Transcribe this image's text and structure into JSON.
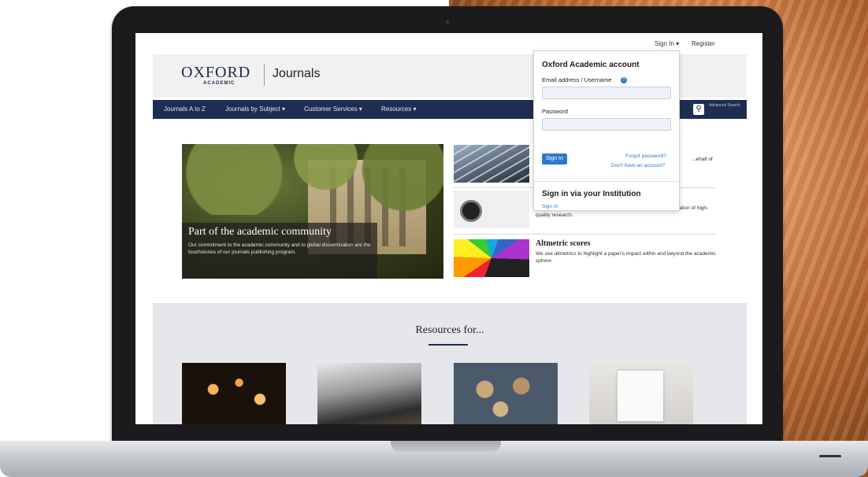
{
  "utility": {
    "sign_in": "Sign In ▾",
    "register": "Register"
  },
  "header": {
    "logo_main": "OXFORD",
    "logo_sub": "ACADEMIC",
    "site_name": "Journals"
  },
  "nav": {
    "items": [
      {
        "label": "Journals A to Z"
      },
      {
        "label": "Journals by Subject ▾"
      },
      {
        "label": "Customer Services ▾"
      },
      {
        "label": "Resources ▾"
      }
    ],
    "search_icon": "search-icon",
    "advanced_search": "Advanced Search"
  },
  "hero": {
    "title": "Part of the academic community",
    "text": "Our commitment to the academic community and to global dissemination are the touchstones of our journals publishing program."
  },
  "features": [
    {
      "title": "",
      "text": "...ehalf of"
    },
    {
      "title": "",
      "text": "We are mission-driven to facilitate the widest possible dissemination of high-quality research."
    },
    {
      "title": "Altmetric scores",
      "text": "We use altmetrics to highlight a paper's impact within and beyond the academic sphere."
    }
  ],
  "resources": {
    "title": "Resources for..."
  },
  "signin_popup": {
    "title": "Oxford Academic account",
    "email_label": "Email address / Username",
    "email_value": "",
    "password_label": "Password",
    "password_value": "",
    "button": "Sign In",
    "forgot": "Forgot password?",
    "no_account": "Don't have an account?",
    "institution_title": "Sign in via your Institution",
    "institution_link": "Sign In"
  },
  "colors": {
    "nav_bg": "#1e2e52",
    "accent": "#2a7ad0",
    "resources_bg": "#e6e7ea"
  }
}
